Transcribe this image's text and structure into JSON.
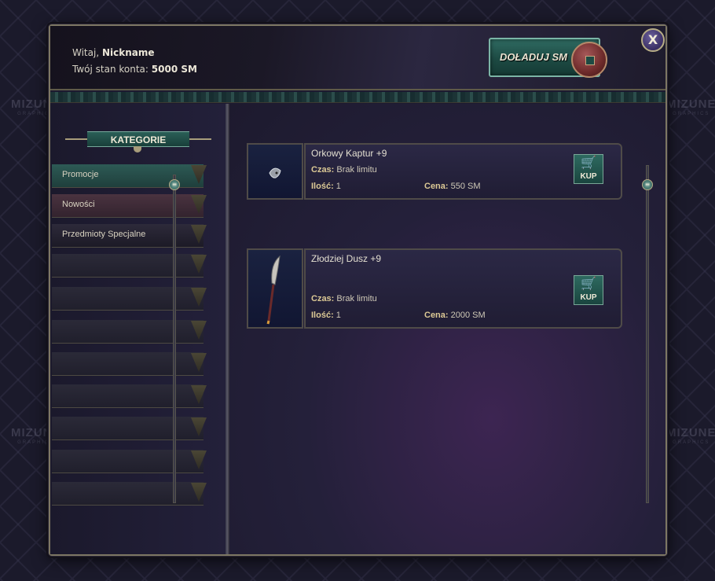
{
  "watermark": {
    "brand": "MIZUNE",
    "sub": "GRAPHICS"
  },
  "header": {
    "greeting_prefix": "Witaj,",
    "nickname": "Nickname",
    "balance_label": "Twój stan konta:",
    "balance_value": "5000 SM",
    "topup_label": "DOŁADUJ SM",
    "close_label": "X"
  },
  "sidebar": {
    "title": "KATEGORIE",
    "items": [
      {
        "label": "Promocje"
      },
      {
        "label": "Nowości"
      },
      {
        "label": "Przedmioty Specjalne"
      },
      {
        "label": ""
      },
      {
        "label": ""
      },
      {
        "label": ""
      },
      {
        "label": ""
      },
      {
        "label": ""
      },
      {
        "label": ""
      },
      {
        "label": ""
      },
      {
        "label": ""
      }
    ]
  },
  "items": [
    {
      "name": "Orkowy Kaptur +9",
      "time_label": "Czas:",
      "time_value": "Brak limitu",
      "qty_label": "Ilość:",
      "qty_value": "1",
      "price_label": "Cena:",
      "price_value": "550 SM",
      "buy_label": "KUP"
    },
    {
      "name": "Złodziej Dusz +9",
      "time_label": "Czas:",
      "time_value": "Brak limitu",
      "qty_label": "Ilość:",
      "qty_value": "1",
      "price_label": "Cena:",
      "price_value": "2000 SM",
      "buy_label": "KUP"
    }
  ],
  "colors": {
    "accent_teal": "#2d5a55",
    "frame_gold": "#7d7763",
    "text_light": "#e3dfd1"
  }
}
